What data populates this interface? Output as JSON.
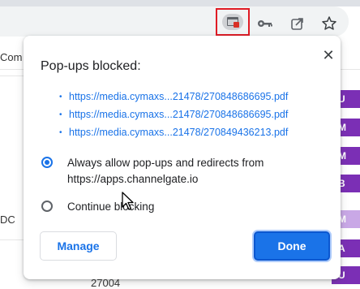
{
  "toolbar": {
    "icons": [
      "popup-blocked-icon",
      "key-icon",
      "share-icon",
      "star-icon"
    ]
  },
  "background": {
    "left_fragments": [
      "Com",
      "DC",
      "27004"
    ],
    "right_tags": [
      "U",
      "M",
      "M",
      "B",
      "M",
      "A",
      "U"
    ]
  },
  "dialog": {
    "title": "Pop-ups blocked:",
    "close_glyph": "✕",
    "links": [
      "https://media.cymaxs...21478/270848686695.pdf",
      "https://media.cymaxs...21478/270848686695.pdf",
      "https://media.cymaxs...21478/270849436213.pdf"
    ],
    "options": [
      {
        "label": "Always allow pop-ups and redirects from https://apps.channelgate.io",
        "checked": true
      },
      {
        "label": "Continue blocking",
        "checked": false
      }
    ],
    "manage_label": "Manage",
    "done_label": "Done"
  },
  "colors": {
    "accent": "#1a73e8",
    "highlight_box": "#e01b24",
    "purple_tag": "#7b2fb5"
  }
}
